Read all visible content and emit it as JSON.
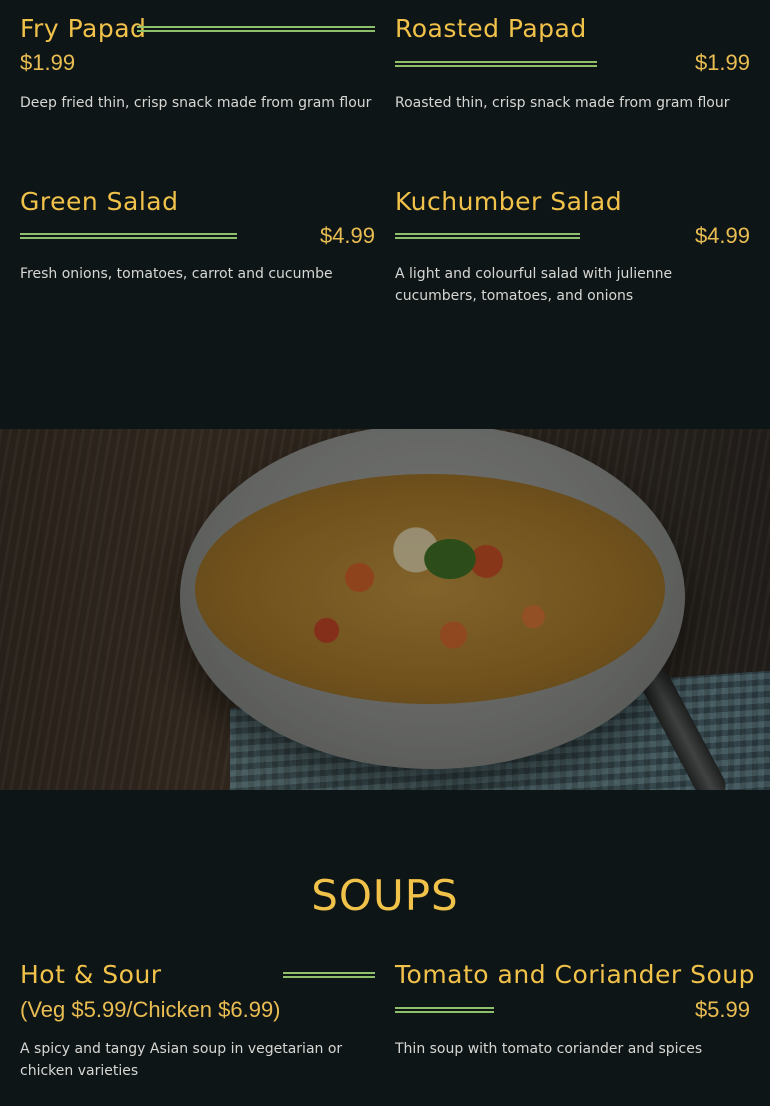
{
  "menu_top": {
    "items": [
      {
        "name": "Fry Papad",
        "price": "$1.99",
        "description": "Deep fried thin, crisp snack made from gram flour"
      },
      {
        "name": "Roasted Papad",
        "price": "$1.99",
        "description": "Roasted thin, crisp snack made from gram flour"
      },
      {
        "name": "Green Salad",
        "price": "$4.99",
        "description": "Fresh onions, tomatoes, carrot and cucumbe"
      },
      {
        "name": "Kuchumber Salad",
        "price": "$4.99",
        "description": "A light and colourful salad with julienne cucumbers, tomatoes, and onions"
      }
    ]
  },
  "soups": {
    "title": "SOUPS",
    "items": [
      {
        "name": "Hot & Sour",
        "price": "(Veg $5.99/Chicken $6.99)",
        "description": "A spicy and tangy Asian soup in vegetarian or chicken varieties"
      },
      {
        "name": "Tomato and Coriander Soup",
        "price": "$5.99",
        "description": "Thin soup with tomato coriander and spices"
      }
    ]
  },
  "colors": {
    "background": "#0e1517",
    "accent_gold": "#f1c24a",
    "rule_green": "#8fbf6a",
    "body_text": "#d7d7d3"
  },
  "hero_image": {
    "icon": "soup-bowl-photo"
  }
}
